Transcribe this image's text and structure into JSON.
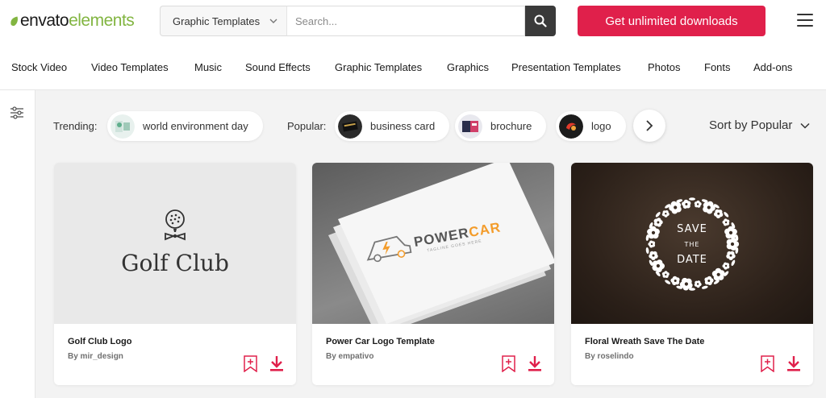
{
  "brand": {
    "word1": "envato",
    "word2": "elements"
  },
  "search": {
    "category": "Graphic Templates",
    "placeholder": "Search..."
  },
  "cta": {
    "label": "Get unlimited downloads"
  },
  "nav": [
    "Stock Video",
    "Video Templates",
    "Music",
    "Sound Effects",
    "Graphic Templates",
    "Graphics",
    "Presentation Templates",
    "Photos",
    "Fonts",
    "Add-ons"
  ],
  "trending": {
    "label": "Trending:",
    "items": [
      {
        "label": "world environment day"
      }
    ]
  },
  "popular": {
    "label": "Popular:",
    "items": [
      {
        "label": "business card"
      },
      {
        "label": "brochure"
      },
      {
        "label": "logo"
      }
    ]
  },
  "sort": {
    "label": "Sort by Popular"
  },
  "colors": {
    "accent": "#e0204b",
    "brand_green": "#82b541",
    "powercar_orange": "#f39c2b"
  },
  "cards": [
    {
      "title": "Golf Club Logo",
      "author": "By mir_design",
      "image_text": "Golf Club"
    },
    {
      "title": "Power Car Logo Template",
      "author": "By empativo",
      "image_text": {
        "word_a": "POWER",
        "word_b": "CAR",
        "tagline": "TAGLINE GOES HERE"
      }
    },
    {
      "title": "Floral Wreath Save The Date",
      "author": "By roselindo",
      "image_text": {
        "line1": "SAVE",
        "line2": "THE",
        "line3": "DATE"
      }
    }
  ],
  "icons": {
    "search": "magnifier-icon",
    "menu": "hamburger-icon",
    "filter": "sliders-icon",
    "next": "chevron-right-icon",
    "bookmark": "bookmark-add-icon",
    "download": "download-icon"
  }
}
